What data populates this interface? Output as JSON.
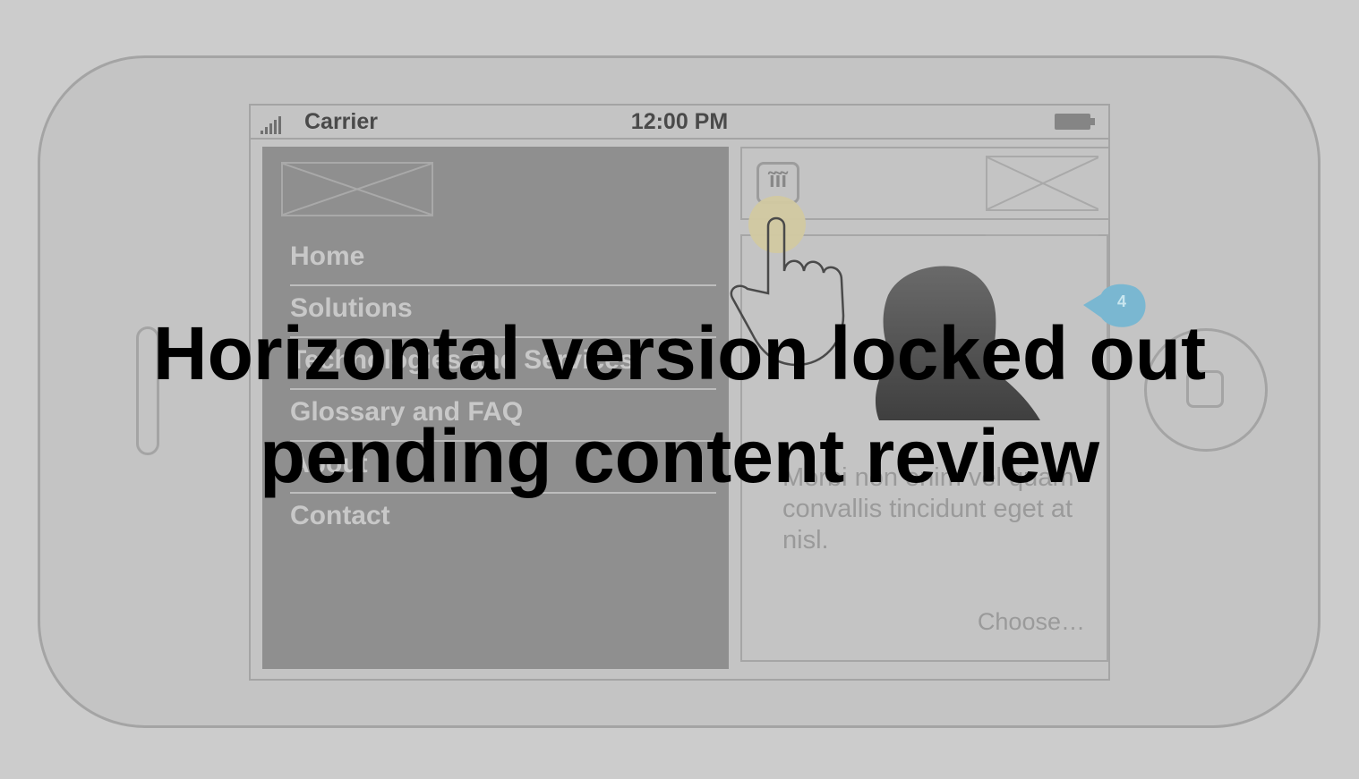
{
  "status_bar": {
    "signal_icon": "signal-bars-icon",
    "carrier": "Carrier",
    "time": "12:00 PM",
    "battery_icon": "battery-icon"
  },
  "menu": {
    "logo": "logo-placeholder",
    "items": [
      {
        "label": "Home"
      },
      {
        "label": "Solutions"
      },
      {
        "label": "Technologies and Services"
      },
      {
        "label": "Glossary and FAQ"
      },
      {
        "label": "About"
      },
      {
        "label": "Contact"
      }
    ]
  },
  "header": {
    "menu_toggle_icon": "sliders-icon",
    "menu_toggle_glyph": "ĩĩĩ",
    "logo": "logo-placeholder"
  },
  "content": {
    "avatar": "person-silhouette",
    "annotation_badge": "4",
    "body_text": "Morbi non enim vel quam convallis tincidunt eget at nisl.",
    "choose_label": "Choose…"
  },
  "gesture": {
    "icon": "tap-hand-icon"
  },
  "overlay": {
    "line1": "Horizontal version locked out",
    "line2": "pending content review"
  },
  "colors": {
    "background": "#cccccc",
    "menu_panel": "#8f8f8f",
    "tap_marker": "#d2c9a1",
    "badge": "#7ab7d1",
    "overlay_text": "#000000"
  }
}
